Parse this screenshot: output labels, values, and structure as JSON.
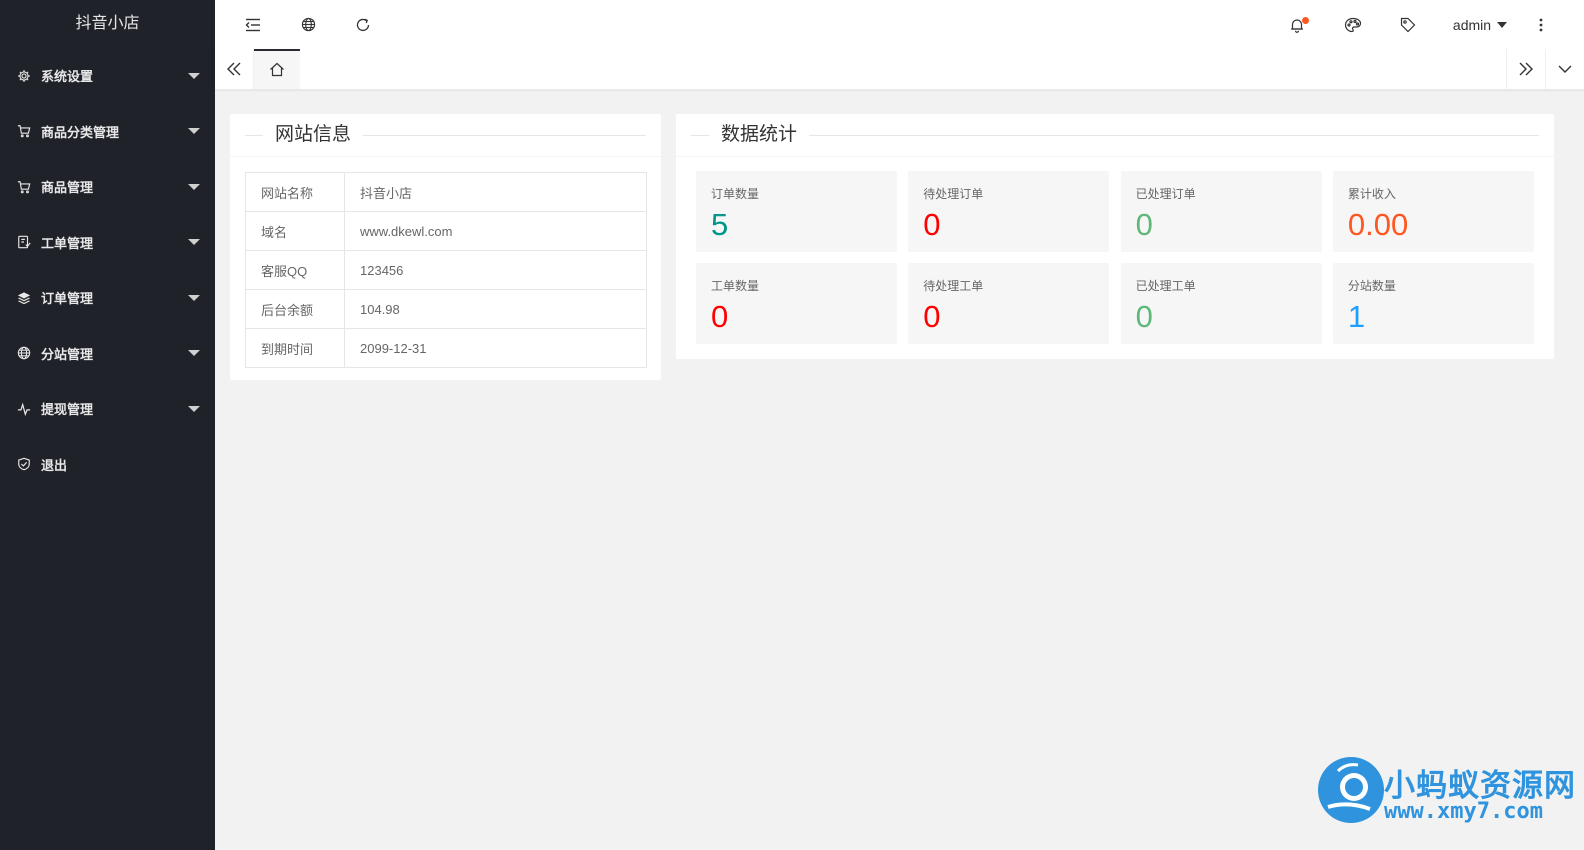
{
  "sidebar": {
    "brand": "抖音小店",
    "items": [
      {
        "label": "系统设置",
        "icon": "gear-icon",
        "caret": true
      },
      {
        "label": "商品分类管理",
        "icon": "cart-icon",
        "caret": true
      },
      {
        "label": "商品管理",
        "icon": "cart-icon",
        "caret": true
      },
      {
        "label": "工单管理",
        "icon": "ticket-icon",
        "caret": true
      },
      {
        "label": "订单管理",
        "icon": "layers-icon",
        "caret": true
      },
      {
        "label": "分站管理",
        "icon": "globe-icon",
        "caret": true
      },
      {
        "label": "提现管理",
        "icon": "pulse-icon",
        "caret": true
      },
      {
        "label": "退出",
        "icon": "shield-icon",
        "caret": false
      }
    ]
  },
  "header": {
    "user": "admin",
    "has_notification": true
  },
  "site_info": {
    "title": "网站信息",
    "rows": [
      {
        "key": "网站名称",
        "value": "抖音小店"
      },
      {
        "key": "域名",
        "value": "www.dkewl.com"
      },
      {
        "key": "客服QQ",
        "value": "123456"
      },
      {
        "key": "后台余额",
        "value": "104.98"
      },
      {
        "key": "到期时间",
        "value": "2099-12-31"
      }
    ]
  },
  "stats": {
    "title": "数据统计",
    "items": [
      {
        "label": "订单数量",
        "value": "5",
        "color": "#009688"
      },
      {
        "label": "待处理订单",
        "value": "0",
        "color": "#ff0000"
      },
      {
        "label": "已处理订单",
        "value": "0",
        "color": "#5fb878"
      },
      {
        "label": "累计收入",
        "value": "0.00",
        "color": "#ff5722"
      },
      {
        "label": "工单数量",
        "value": "0",
        "color": "#ff0000"
      },
      {
        "label": "待处理工单",
        "value": "0",
        "color": "#ff0000"
      },
      {
        "label": "已处理工单",
        "value": "0",
        "color": "#5fb878"
      },
      {
        "label": "分站数量",
        "value": "1",
        "color": "#1e9fff"
      }
    ]
  },
  "watermark": {
    "name": "小蚂蚁资源网",
    "url": "www.xmy7.com"
  }
}
